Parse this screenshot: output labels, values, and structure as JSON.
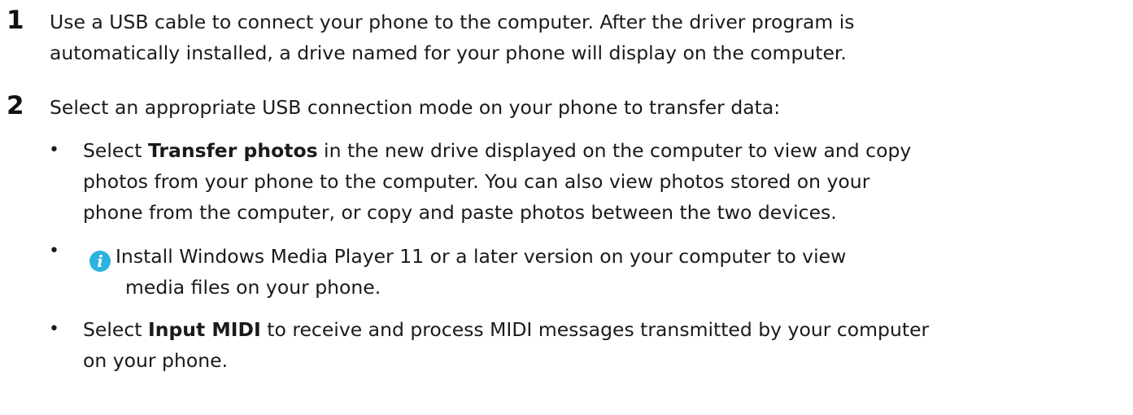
{
  "steps": [
    {
      "number": "1",
      "lines": [
        "Use a USB cable to connect your phone to the computer. After the driver program is",
        "automatically installed, a drive named for your phone will display on the computer."
      ]
    },
    {
      "number": "2",
      "lines": [
        "Select an appropriate USB connection mode on your phone to transfer data:"
      ]
    }
  ],
  "bullets": {
    "transfer_photos": {
      "dot": "•",
      "pre": "Select ",
      "bold": "Transfer photos",
      "line1_rest": " in the new drive displayed on the computer to view and copy",
      "line2": "photos from your phone to the computer. You can also view photos stored on your",
      "line3": "phone from the computer, or copy and paste photos between the two devices."
    },
    "note": {
      "dot": "•",
      "icon": "info-icon",
      "icon_glyph": "i",
      "icon_color": "#2bb3e0",
      "line1": "Install Windows Media Player 11 or a later version on your computer to view",
      "line2": "media files on your phone."
    },
    "input_midi": {
      "dot": "•",
      "pre": "Select ",
      "bold": "Input MIDI",
      "line1_rest": " to receive and process MIDI messages transmitted by your computer",
      "line2": "on your phone."
    }
  }
}
